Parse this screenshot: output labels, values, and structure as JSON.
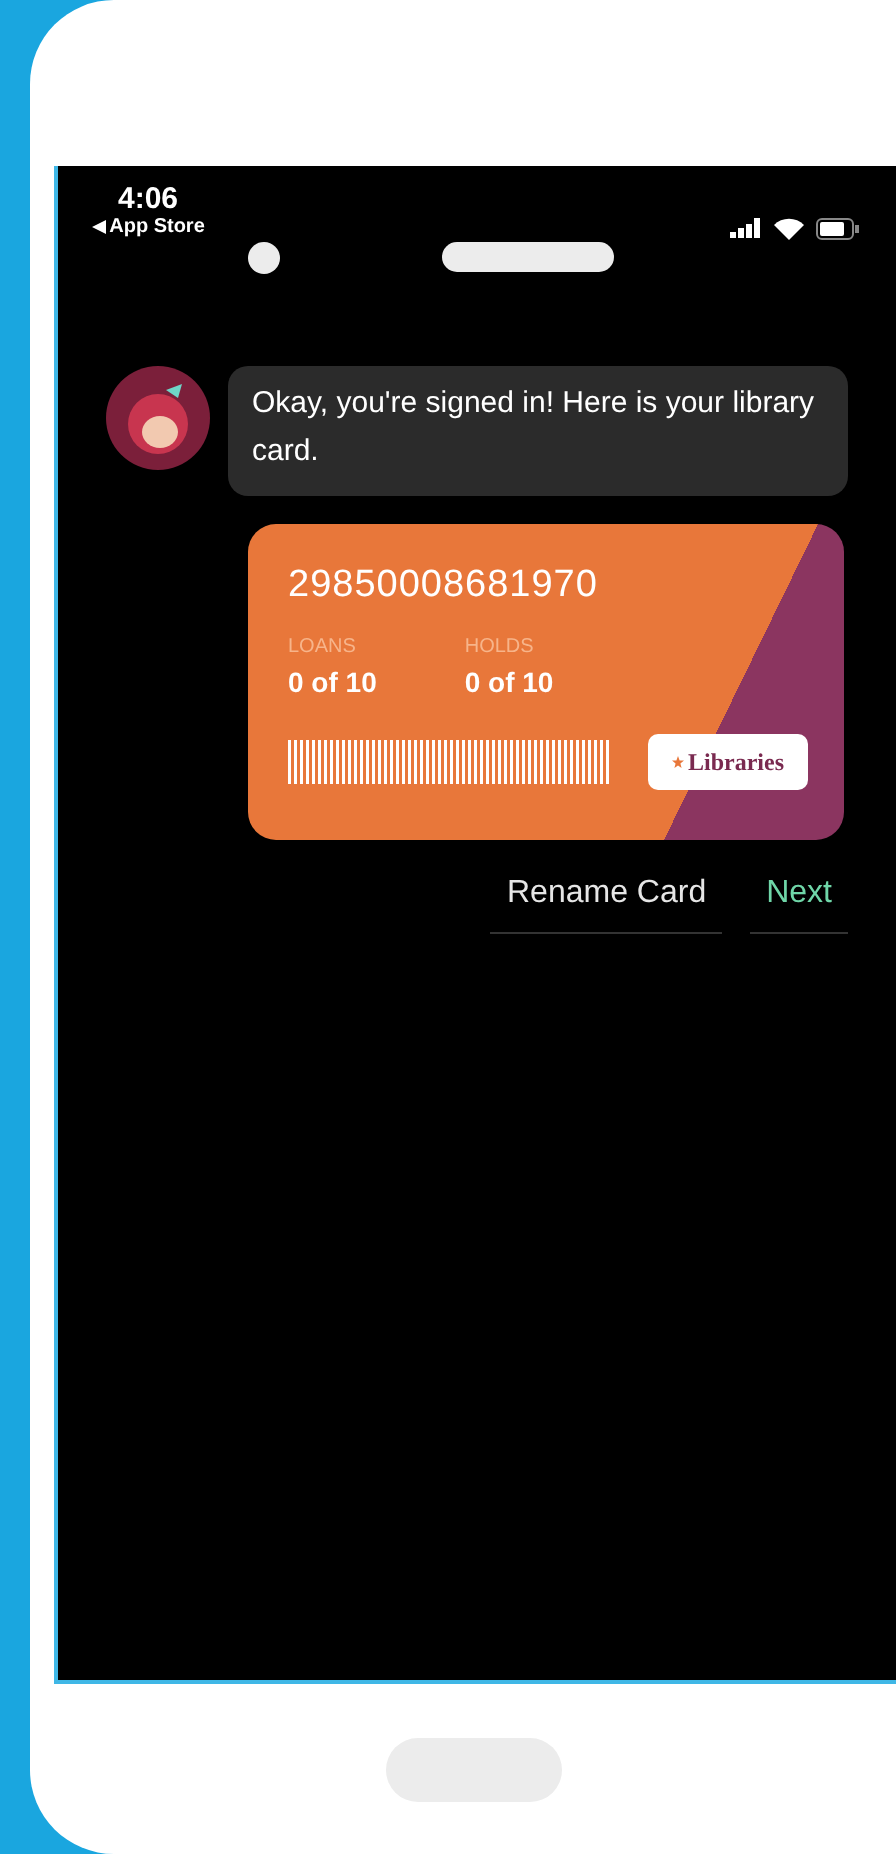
{
  "status_bar": {
    "time": "4:06",
    "back_label": "App Store"
  },
  "message": "Okay, you're signed in! Here is your library card.",
  "card": {
    "number": "29850008681970",
    "stats": [
      {
        "label": "LOANS",
        "value": "0 of 10"
      },
      {
        "label": "HOLDS",
        "value": "0 of 10"
      }
    ],
    "logo_text": "Libraries"
  },
  "buttons": [
    {
      "label": "Rename Card",
      "kind": "secondary"
    },
    {
      "label": "Next",
      "kind": "primary"
    }
  ]
}
